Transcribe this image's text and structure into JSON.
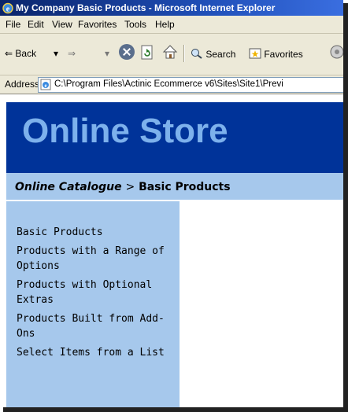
{
  "window": {
    "title": "My Company Basic Products - Microsoft Internet Explorer"
  },
  "menu": {
    "items": [
      "File",
      "Edit",
      "View",
      "Favorites",
      "Tools",
      "Help"
    ]
  },
  "toolbar": {
    "back_label": "Back",
    "search_label": "Search",
    "favorites_label": "Favorites"
  },
  "address": {
    "label": "Address",
    "url": "C:\\Program Files\\Actinic Ecommerce v6\\Sites\\Site1\\Previ"
  },
  "page": {
    "store_title": "Online Store",
    "breadcrumb": {
      "link": "Online Catalogue",
      "separator": ">",
      "current": "Basic Products"
    },
    "sidebar": {
      "items": [
        "Basic Products",
        "Products with a Range of Options",
        "Products with Optional Extras",
        "Products Built from Add-Ons",
        "Select Items from a List"
      ]
    }
  },
  "colors": {
    "titlebar": "#0a246a",
    "header_band": "#003399",
    "store_title": "#7db1ec",
    "light_band": "#a6c8ec",
    "chrome": "#ece9d8"
  }
}
